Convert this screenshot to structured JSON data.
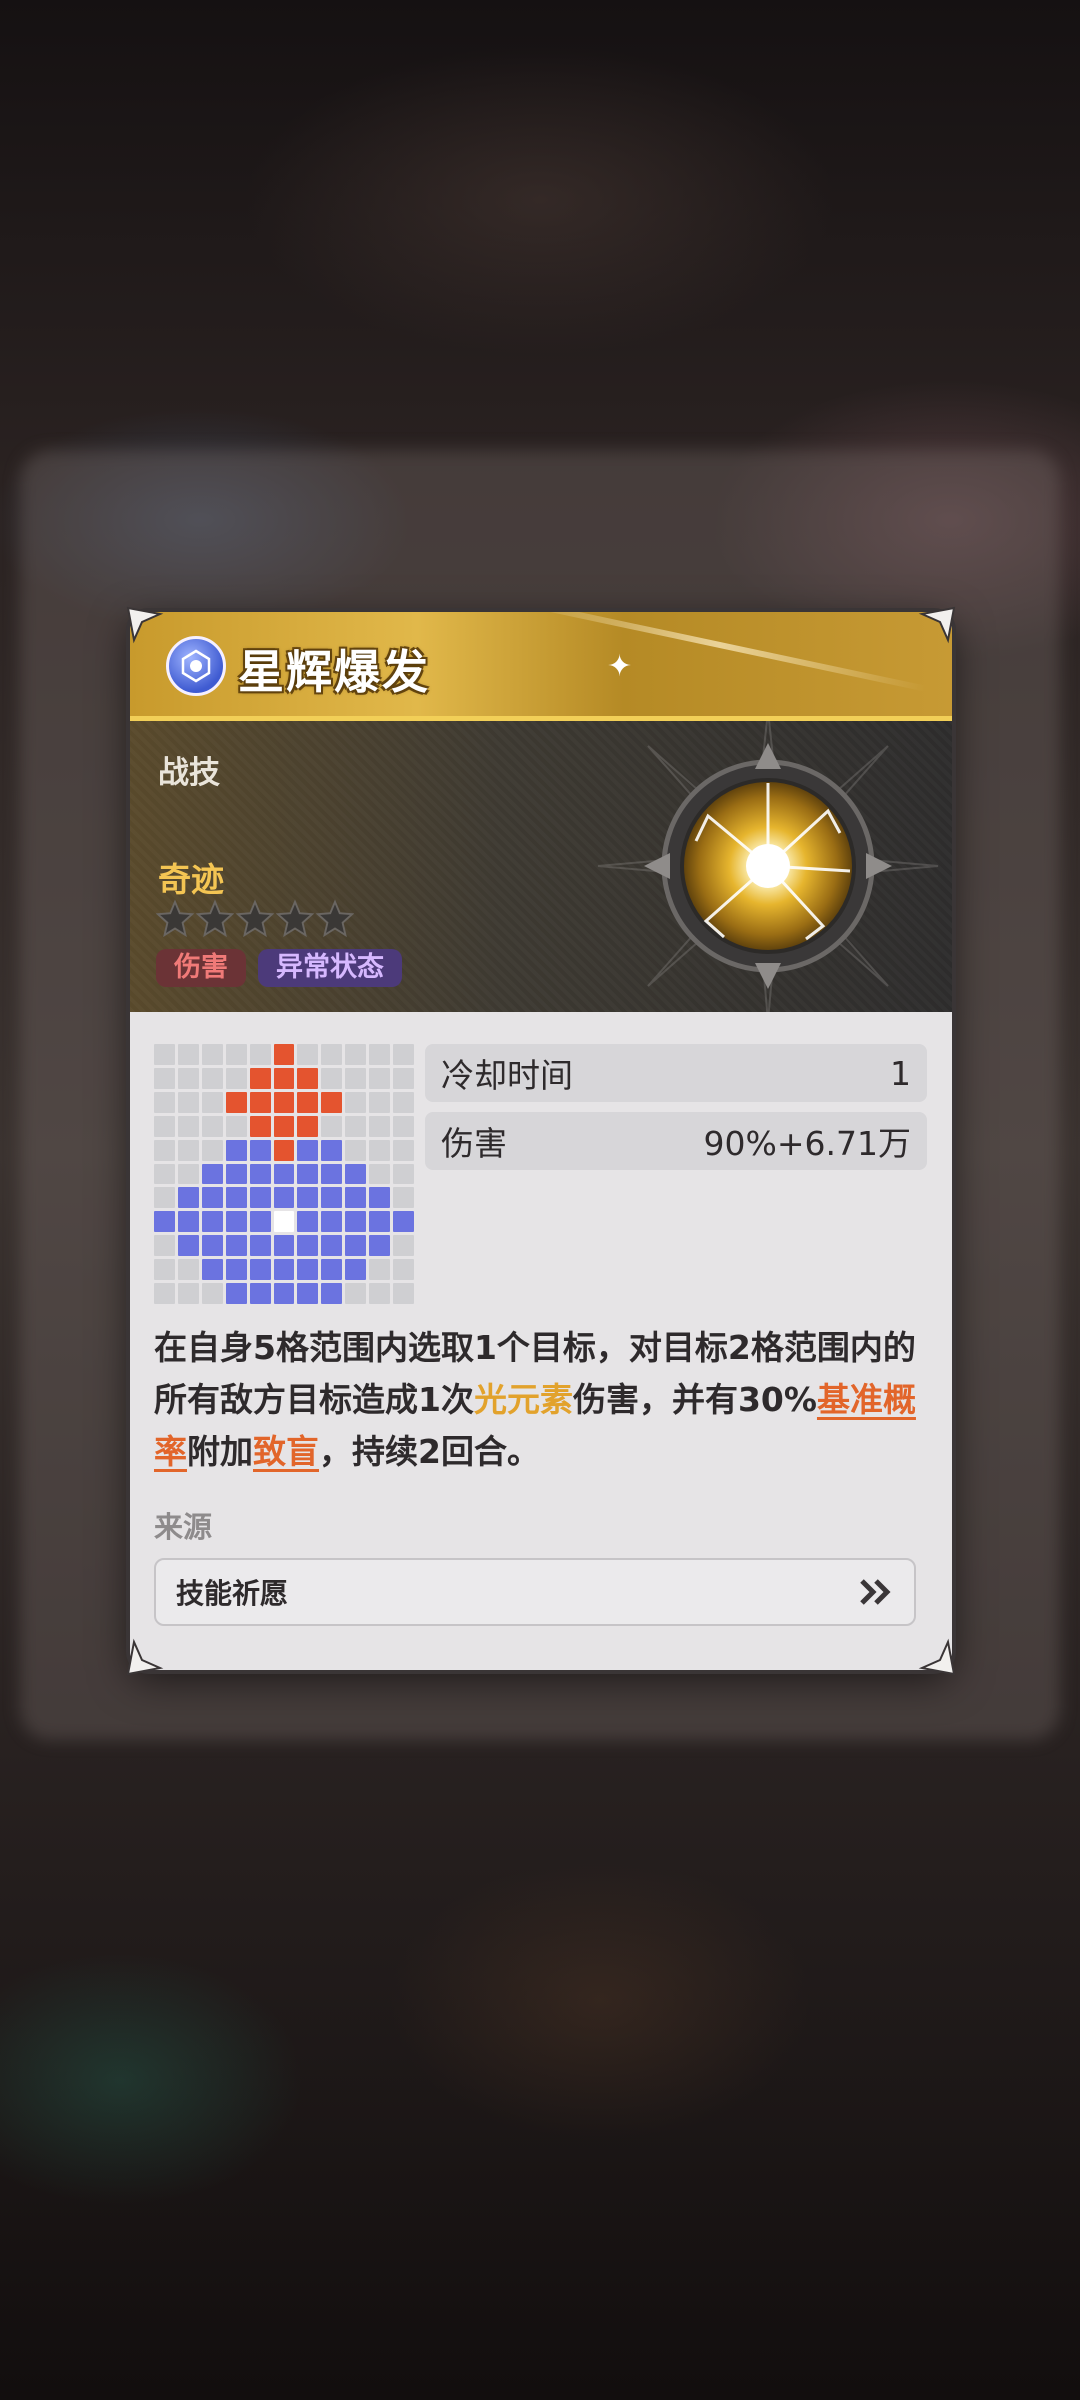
{
  "skill": {
    "name": "星辉爆发",
    "type": "战技",
    "rarity_name": "奇迹",
    "stars_filled": 0,
    "stars_total": 5,
    "tags": [
      "伤害",
      "异常状态"
    ],
    "element_icon": "light-element-icon",
    "emblem_icon": "light-orb-skill-icon"
  },
  "stats": {
    "cooldown_label": "冷却时间",
    "cooldown_value": "1",
    "damage_label": "伤害",
    "damage_value": "90%+6.71万"
  },
  "description": {
    "part1": "在自身5格范围内选取1个目标，对目标2格范围内的所有敌方目标造成1次",
    "element": "光元素",
    "part2": "伤害，并有30%",
    "keyword_chance": "基准概率",
    "part3": "附加",
    "keyword_status": "致盲",
    "part4": "，持续2回合。"
  },
  "source": {
    "label": "来源",
    "button_label": "技能祈愿",
    "button_icon": "double-chevron-right-icon"
  },
  "range_grid": {
    "size": 11,
    "red_cells": [
      [
        0,
        5
      ],
      [
        1,
        4
      ],
      [
        1,
        5
      ],
      [
        1,
        6
      ],
      [
        2,
        3
      ],
      [
        2,
        4
      ],
      [
        2,
        5
      ],
      [
        2,
        6
      ],
      [
        2,
        7
      ],
      [
        3,
        4
      ],
      [
        3,
        5
      ],
      [
        3,
        6
      ],
      [
        4,
        5
      ]
    ],
    "blue_cells": [
      [
        4,
        3
      ],
      [
        4,
        4
      ],
      [
        4,
        6
      ],
      [
        4,
        7
      ],
      [
        5,
        2
      ],
      [
        5,
        3
      ],
      [
        5,
        4
      ],
      [
        5,
        5
      ],
      [
        5,
        6
      ],
      [
        5,
        7
      ],
      [
        5,
        8
      ],
      [
        6,
        1
      ],
      [
        6,
        2
      ],
      [
        6,
        3
      ],
      [
        6,
        4
      ],
      [
        6,
        5
      ],
      [
        6,
        6
      ],
      [
        6,
        7
      ],
      [
        6,
        8
      ],
      [
        6,
        9
      ],
      [
        7,
        0
      ],
      [
        7,
        1
      ],
      [
        7,
        2
      ],
      [
        7,
        3
      ],
      [
        7,
        4
      ],
      [
        7,
        6
      ],
      [
        7,
        7
      ],
      [
        7,
        8
      ],
      [
        7,
        9
      ],
      [
        7,
        10
      ],
      [
        8,
        1
      ],
      [
        8,
        2
      ],
      [
        8,
        3
      ],
      [
        8,
        4
      ],
      [
        8,
        5
      ],
      [
        8,
        6
      ],
      [
        8,
        7
      ],
      [
        8,
        8
      ],
      [
        8,
        9
      ],
      [
        9,
        2
      ],
      [
        9,
        3
      ],
      [
        9,
        4
      ],
      [
        9,
        5
      ],
      [
        9,
        6
      ],
      [
        9,
        7
      ],
      [
        9,
        8
      ],
      [
        10,
        3
      ],
      [
        10,
        4
      ],
      [
        10,
        5
      ],
      [
        10,
        6
      ],
      [
        10,
        7
      ]
    ],
    "self_cell": [
      7,
      5
    ]
  },
  "colors": {
    "title_gold": "#e1b84a",
    "rarity_gold": "#f4c553",
    "highlight_orange": "#e2652a",
    "element_gold": "#e2a22c",
    "range_red": "#e4542f",
    "range_blue": "#6b73e0"
  }
}
